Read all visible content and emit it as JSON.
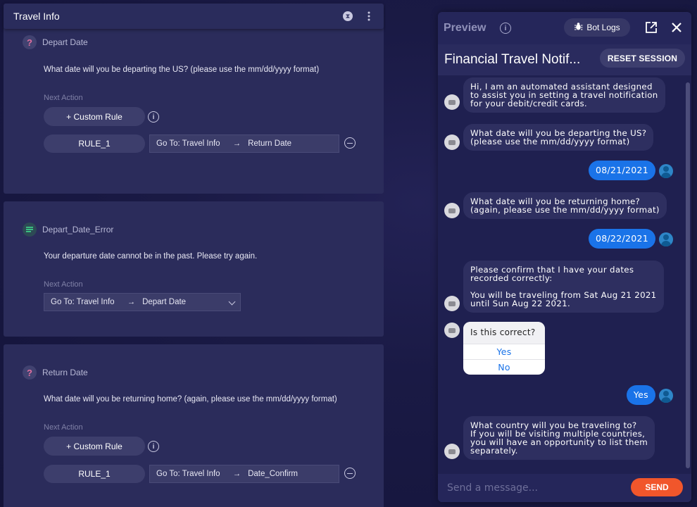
{
  "topbar": {
    "title": "Travel Info"
  },
  "nodes": [
    {
      "name": "Depart Date",
      "icon": "question-icon",
      "prompt": "What date will you be departing the US? (please use the mm/dd/yyyy format)",
      "next_action_label": "Next Action",
      "custom_rule_label": "+ Custom Rule",
      "rule_label": "RULE_1",
      "goto_prefix": "Go To: Travel Info",
      "goto_target": "Return Date"
    },
    {
      "name": "Depart_Date_Error",
      "icon": "message-icon",
      "prompt": "Your departure date cannot be in the past. Please try again.",
      "next_action_label": "Next Action",
      "goto_prefix": "Go To: Travel Info",
      "goto_target": "Depart Date"
    },
    {
      "name": "Return Date",
      "icon": "question-icon",
      "prompt": "What date will you be returning home? (again, please use the mm/dd/yyyy format)",
      "next_action_label": "Next Action",
      "custom_rule_label": "+ Custom Rule",
      "rule_label": "RULE_1",
      "goto_prefix": "Go To: Travel Info",
      "goto_target": "Date_Confirm"
    }
  ],
  "preview": {
    "title": "Preview",
    "bot_logs_label": "Bot Logs",
    "bot_name": "Financial Travel Notif...",
    "reset_label": "RESET SESSION",
    "messages": [
      {
        "from": "bot",
        "text": "Hi, I am an automated assistant designed\nto assist you in setting a travel notification\nfor your debit/credit cards."
      },
      {
        "from": "bot",
        "text": "What date will you be departing the US?\n(please use the mm/dd/yyyy format)"
      },
      {
        "from": "user",
        "text": "08/21/2021"
      },
      {
        "from": "bot",
        "text": "What date will you be returning home?\n(again, please use the mm/dd/yyyy format)"
      },
      {
        "from": "user",
        "text": "08/22/2021"
      },
      {
        "from": "bot",
        "text": "Please confirm that I have your dates\nrecorded correctly:\n\nYou will be traveling from Sat Aug 21 2021\nuntil Sun Aug 22 2021."
      },
      {
        "from": "bot",
        "text": "Is this correct?",
        "options": [
          "Yes",
          "No"
        ]
      },
      {
        "from": "user",
        "text": "Yes"
      },
      {
        "from": "bot",
        "text": "What country will you be traveling to?\nIf you will be visiting multiple countries,\nyou will have an opportunity to list them\nseparately."
      }
    ],
    "composer_placeholder": "Send a message...",
    "send_label": "SEND"
  }
}
